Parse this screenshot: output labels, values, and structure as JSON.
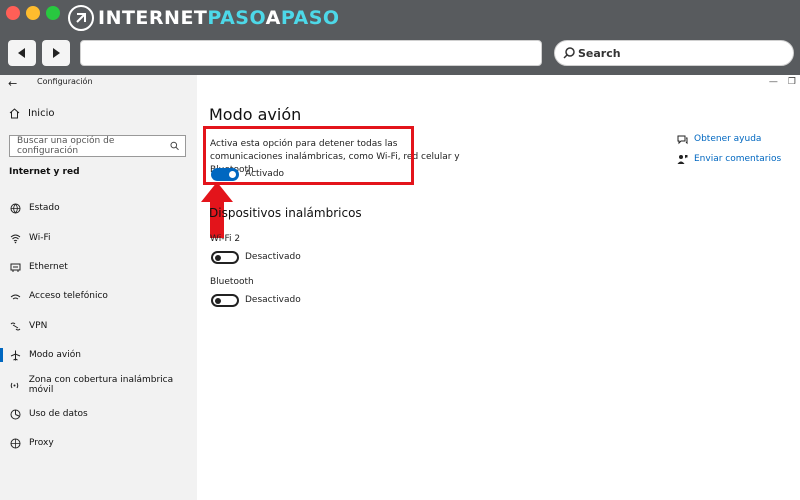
{
  "browser": {
    "logo_text_part1": "INTERNET",
    "logo_text_part2": "PASO",
    "logo_text_part3": "A",
    "logo_text_part4": "PASO",
    "search_placeholder": "Search"
  },
  "window": {
    "title": "Configuración"
  },
  "sidebar": {
    "home_label": "Inicio",
    "search_placeholder": "Buscar una opción de configuración",
    "section_title": "Internet y red",
    "items": [
      {
        "label": "Estado",
        "icon": "globe-icon"
      },
      {
        "label": "Wi-Fi",
        "icon": "wifi-icon"
      },
      {
        "label": "Ethernet",
        "icon": "ethernet-icon"
      },
      {
        "label": "Acceso telefónico",
        "icon": "dialup-icon"
      },
      {
        "label": "VPN",
        "icon": "vpn-icon"
      },
      {
        "label": "Modo avión",
        "icon": "airplane-icon",
        "active": true
      },
      {
        "label": "Zona con cobertura inalámbrica móvil",
        "icon": "hotspot-icon"
      },
      {
        "label": "Uso de datos",
        "icon": "data-usage-icon"
      },
      {
        "label": "Proxy",
        "icon": "proxy-globe-icon"
      }
    ]
  },
  "main": {
    "title": "Modo avión",
    "description": "Activa esta opción para detener todas las comunicaciones inalámbricas, como Wi-Fi, red celular y Bluetooth.",
    "airplane_toggle": {
      "state": "on",
      "label": "Activado"
    },
    "wireless_section_title": "Dispositivos inalámbricos",
    "devices": [
      {
        "name": "Wi-Fi 2",
        "state": "off",
        "label": "Desactivado"
      },
      {
        "name": "Bluetooth",
        "state": "off",
        "label": "Desactivado"
      }
    ]
  },
  "help": {
    "get_help": "Obtener ayuda",
    "send_feedback": "Enviar comentarios"
  },
  "colors": {
    "accent": "#0067c0",
    "highlight": "#e3141b",
    "chrome": "#585b5e"
  }
}
